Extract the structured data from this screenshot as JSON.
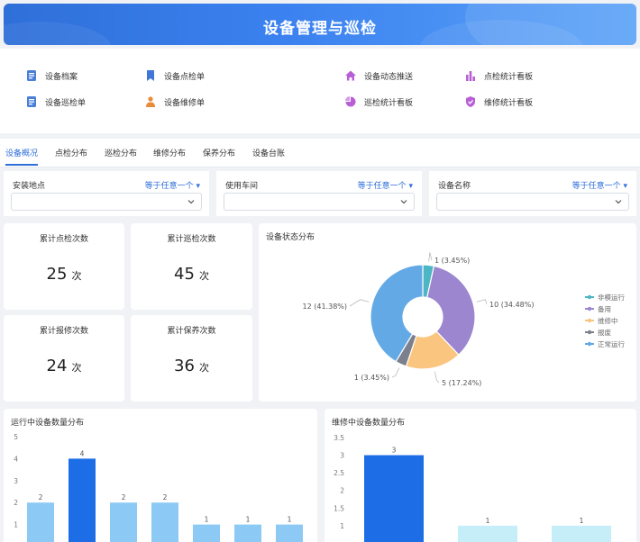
{
  "header": {
    "title": "设备管理与巡检"
  },
  "quick_links": [
    {
      "label": "设备档案",
      "icon": "document-icon",
      "color": "#4a7fd9"
    },
    {
      "label": "设备点检单",
      "icon": "bookmark-icon",
      "color": "#3f76d8"
    },
    {
      "label": "设备动态推送",
      "icon": "home-icon",
      "color": "#b85fd6"
    },
    {
      "label": "点检统计看板",
      "icon": "bar-chart-icon",
      "color": "#b85fd6"
    },
    {
      "label": "设备巡检单",
      "icon": "document-icon",
      "color": "#4a7fd9"
    },
    {
      "label": "设备维修单",
      "icon": "worker-icon",
      "color": "#e88b3a"
    },
    {
      "label": "巡检统计看板",
      "icon": "pie-chart-icon",
      "color": "#b85fd6"
    },
    {
      "label": "维修统计看板",
      "icon": "shield-icon",
      "color": "#b85fd6"
    }
  ],
  "tabs": [
    {
      "label": "设备概况",
      "active": true
    },
    {
      "label": "点检分布",
      "active": false
    },
    {
      "label": "巡检分布",
      "active": false
    },
    {
      "label": "维修分布",
      "active": false
    },
    {
      "label": "保养分布",
      "active": false
    },
    {
      "label": "设备台账",
      "active": false
    }
  ],
  "filters": [
    {
      "label": "安装地点",
      "operator": "等于任意一个",
      "value": ""
    },
    {
      "label": "使用车间",
      "operator": "等于任意一个",
      "value": ""
    },
    {
      "label": "设备名称",
      "operator": "等于任意一个",
      "value": ""
    }
  ],
  "stats": [
    {
      "label": "累计点检次数",
      "value": "25",
      "unit": "次"
    },
    {
      "label": "累计巡检次数",
      "value": "45",
      "unit": "次"
    },
    {
      "label": "累计报修次数",
      "value": "24",
      "unit": "次"
    },
    {
      "label": "累计保养次数",
      "value": "36",
      "unit": "次"
    }
  ],
  "chart_data": [
    {
      "type": "pie",
      "title": "设备状态分布",
      "donut": true,
      "slices": [
        {
          "name": "非模运行",
          "value": 1,
          "label": "1 (3.45%)",
          "color": "#4db6c4"
        },
        {
          "name": "备用",
          "value": 10,
          "label": "10 (34.48%)",
          "color": "#9b86cf"
        },
        {
          "name": "维修中",
          "value": 5,
          "label": "5 (17.24%)",
          "color": "#fac57f"
        },
        {
          "name": "报废",
          "value": 1,
          "label": "1 (3.45%)",
          "color": "#7c7f8c"
        },
        {
          "name": "正常运行",
          "value": 12,
          "label": "12 (41.38%)",
          "color": "#62a9e6"
        }
      ],
      "legend_position": "right",
      "legend": [
        "非模运行",
        "备用",
        "维修中",
        "报废",
        "正常运行"
      ]
    },
    {
      "type": "bar",
      "title": "运行中设备数量分布",
      "ylim": [
        0,
        5
      ],
      "yticks": [
        1,
        2,
        3,
        4,
        5
      ],
      "values": [
        2,
        4,
        2,
        2,
        1,
        1,
        1
      ],
      "bar_colors": [
        "#8ccaf5",
        "#1d6ee6",
        "#8ccaf5",
        "#8ccaf5",
        "#8ccaf5",
        "#8ccaf5",
        "#8ccaf5"
      ]
    },
    {
      "type": "bar",
      "title": "维修中设备数量分布",
      "ylim": [
        0,
        3.5
      ],
      "yticks": [
        1,
        1.5,
        2,
        2.5,
        3,
        3.5
      ],
      "values": [
        3,
        1,
        1
      ],
      "bar_colors": [
        "#1d6ee6",
        "#c6eef9",
        "#c6eef9"
      ]
    }
  ]
}
